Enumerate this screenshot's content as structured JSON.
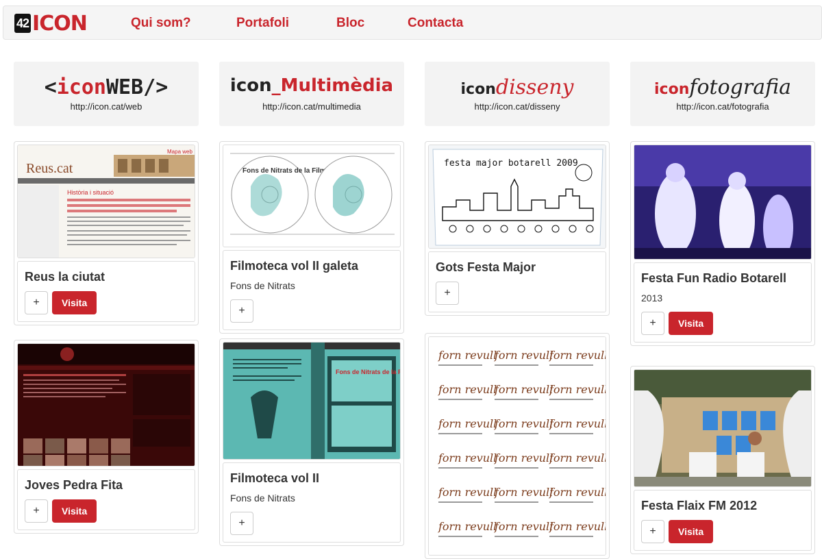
{
  "nav": {
    "logo_num": "42",
    "logo_text": "ICON",
    "links": [
      "Qui som?",
      "Portafoli",
      "Bloc",
      "Contacta"
    ]
  },
  "banners": [
    {
      "brand_a": "<",
      "brand_b": "icon",
      "brand_c": "WEB/>",
      "url": "http://icon.cat/web"
    },
    {
      "brand_a": "icon",
      "brand_b": "_Multimèdia",
      "url": "http://icon.cat/multimedia"
    },
    {
      "brand_a": "icon",
      "brand_b": "disseny",
      "url": "http://icon.cat/disseny"
    },
    {
      "brand_a": "icon",
      "brand_b": "fotografia",
      "url": "http://icon.cat/fotografia"
    }
  ],
  "cards": {
    "reus": {
      "title": "Reus la ciutat",
      "thumb_site": "Reus.cat",
      "thumb_link": "Mapa web",
      "thumb_heading": "Història i situació"
    },
    "joves": {
      "title": "Joves Pedra Fita"
    },
    "filgal": {
      "title": "Filmoteca vol II galeta",
      "subtitle": "Fons de Nitrats",
      "thumb_text": "Fons de Nitrats de la FilmoTeca"
    },
    "filvol": {
      "title": "Filmoteca vol II",
      "subtitle": "Fons de Nitrats",
      "thumb_text": "Fons de Nitrats de la FilmoTeca"
    },
    "gots": {
      "title": "Gots Festa Major",
      "thumb_text": "festa major botarell 2009"
    },
    "forn": {
      "thumb_text": "forn revull"
    },
    "funr": {
      "title": "Festa Fun Radio Botarell",
      "subtitle": "2013"
    },
    "flaix": {
      "title": "Festa Flaix FM 2012"
    }
  },
  "buttons": {
    "plus": "+",
    "visit": "Visita"
  }
}
